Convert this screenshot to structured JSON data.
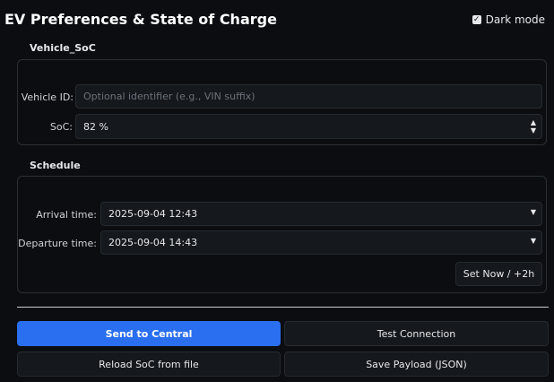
{
  "header": {
    "title": "EV Preferences & State of Charge",
    "dark_mode_label": "Dark mode",
    "dark_mode_checked": true
  },
  "vehicle": {
    "section_label": "Vehicle_SoC",
    "vehicle_id_label": "Vehicle ID:",
    "vehicle_id_value": "",
    "vehicle_id_placeholder": "Optional identifier (e.g., VIN suffix)",
    "soc_label": "SoC:",
    "soc_value": "82 %"
  },
  "schedule": {
    "section_label": "Schedule",
    "arrival_label": "Arrival time:",
    "arrival_value": "2025-09-04 12:43",
    "departure_label": "Departure time:",
    "departure_value": "2025-09-04 14:43",
    "set_now_label": "Set Now / +2h"
  },
  "actions": {
    "send_label": "Send to Central",
    "test_label": "Test Connection",
    "reload_label": "Reload SoC from file",
    "save_label": "Save Payload (JSON)"
  }
}
